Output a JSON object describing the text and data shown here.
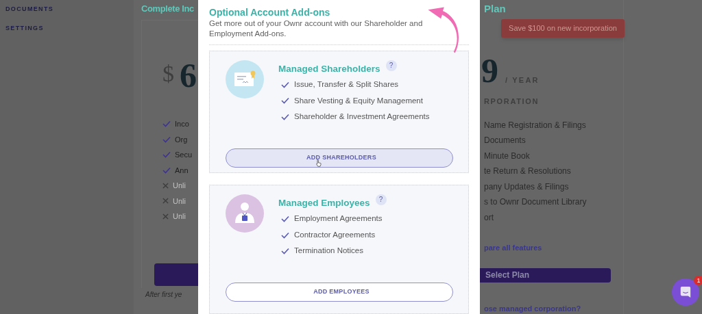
{
  "sidebar": {
    "items": [
      {
        "label": "DOCUMENTS"
      },
      {
        "label": "SETTINGS"
      }
    ]
  },
  "left_plan": {
    "title": "Complete Inc",
    "currency": "$",
    "price": "6",
    "features": [
      {
        "text": "Inco",
        "included": true
      },
      {
        "text": "Org",
        "included": true
      },
      {
        "text": "Secu",
        "included": true
      },
      {
        "text": "Ann",
        "included": true
      },
      {
        "text": "Unli",
        "included": false
      },
      {
        "text": "Unli",
        "included": false
      },
      {
        "text": "Unli",
        "included": false
      }
    ],
    "footnote": "After first ye"
  },
  "modal": {
    "title": "Optional Account Add-ons",
    "description": "Get more out of your Ownr account with our Shareholder and Employment Add-ons.",
    "addons": [
      {
        "kind": "shareholders",
        "title": "Managed Shareholders",
        "help": "?",
        "features": [
          "Issue, Transfer & Split Shares",
          "Share Vesting & Equity Management",
          "Shareholder & Investment Agreements"
        ],
        "button": "ADD SHAREHOLDERS",
        "hovered": true
      },
      {
        "kind": "employees",
        "title": "Managed Employees",
        "help": "?",
        "features": [
          "Employment Agreements",
          "Contractor Agreements",
          "Termination Notices"
        ],
        "button": "ADD EMPLOYEES",
        "hovered": false
      }
    ]
  },
  "right_plan": {
    "title": "Plan",
    "promo": "Save $100 on new incorporation",
    "price": "9",
    "period": "/ YEAR",
    "subtitle": "RPORATION",
    "features": [
      "Name Registration & Filings",
      "Documents",
      "Minute Book",
      "te Return & Resolutions",
      "pany Updates & Filings",
      "s to Ownr Document Library",
      "ort"
    ],
    "compare_link": "pare all features",
    "select_button": "Select Plan",
    "footer_link": "ose managed corporation?"
  },
  "chat": {
    "badge": "1"
  }
}
